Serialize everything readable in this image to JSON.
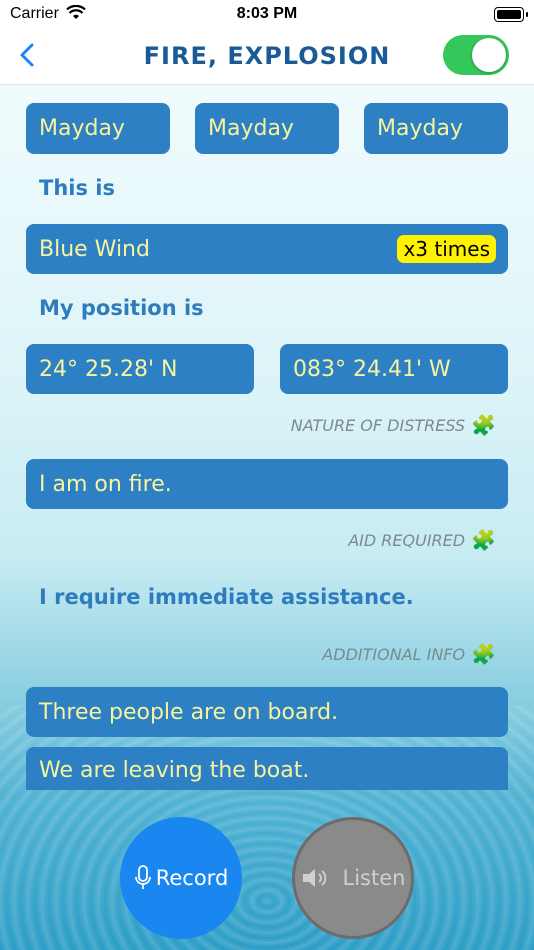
{
  "status_bar": {
    "carrier": "Carrier",
    "time": "8:03 PM"
  },
  "header": {
    "title": "FIRE, EXPLOSION",
    "toggle_on": true
  },
  "mayday": [
    "Mayday",
    "Mayday",
    "Mayday"
  ],
  "this_is": {
    "label": "This is",
    "vessel": "Blue Wind",
    "badge": "x3 times"
  },
  "position": {
    "label": "My position is",
    "lat": "24° 25.28' N",
    "lon": "083° 24.41' W"
  },
  "nature": {
    "heading": "NATURE OF DISTRESS",
    "text": "I am on fire."
  },
  "aid": {
    "heading": "AID REQUIRED",
    "text": "I require immediate assistance."
  },
  "additional": {
    "heading": "ADDITIONAL INFO",
    "items": [
      "Three people are on board.",
      "We are leaving the boat."
    ]
  },
  "buttons": {
    "record": "Record",
    "listen": "Listen"
  },
  "colors": {
    "accent": "#1a5a96",
    "box": "#2e80c4",
    "box_text": "#f7f39e",
    "toggle": "#34c759",
    "badge": "#fff200"
  }
}
